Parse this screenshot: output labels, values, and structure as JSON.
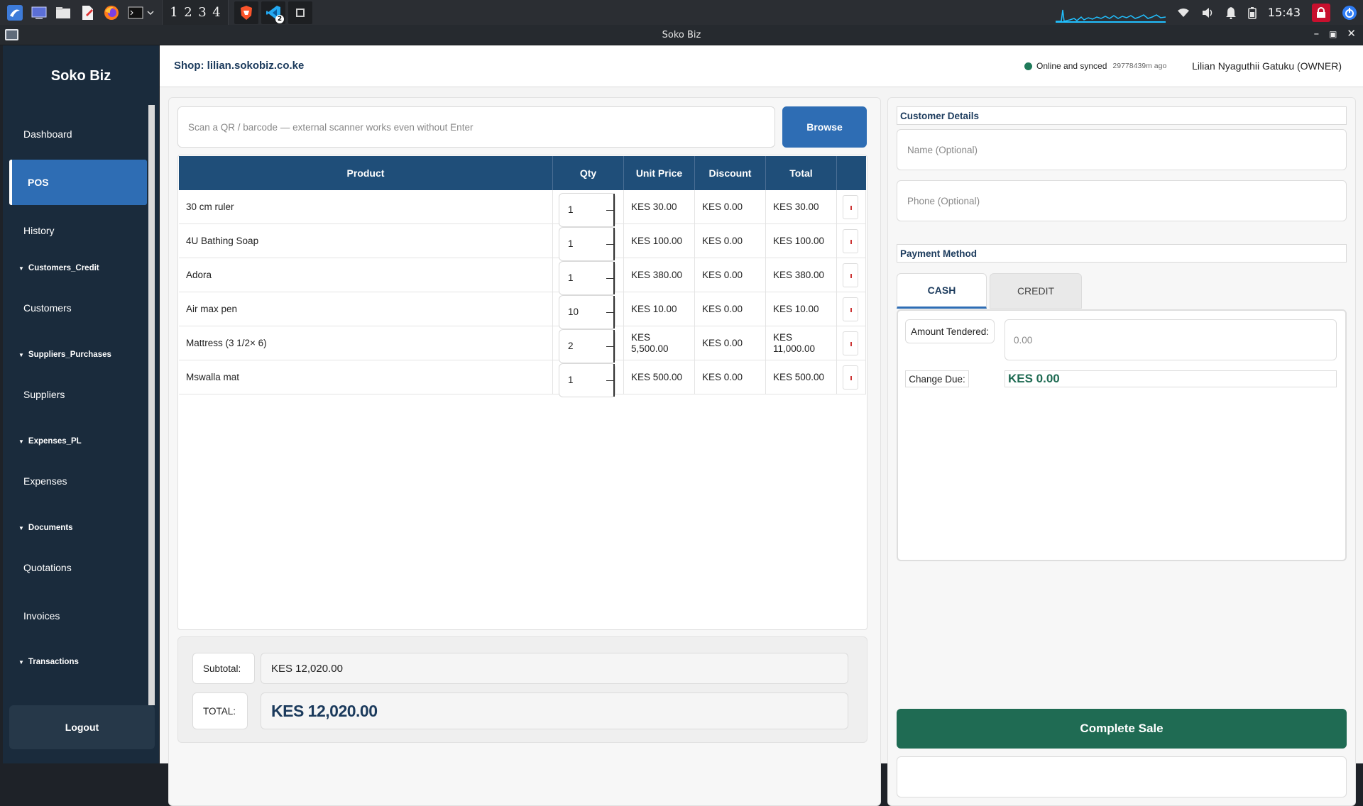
{
  "panel": {
    "workspaces": [
      "1",
      "2",
      "3",
      "4"
    ],
    "vscode_badge": "2",
    "clock": "15:43"
  },
  "window": {
    "title": "Soko Biz"
  },
  "sidebar": {
    "brand": "Soko Biz",
    "items": {
      "dashboard": "Dashboard",
      "pos": "POS",
      "history": "History",
      "group_customers": "Customers_Credit",
      "customers": "Customers",
      "group_suppliers": "Suppliers_Purchases",
      "suppliers": "Suppliers",
      "group_expenses": "Expenses_PL",
      "expenses": "Expenses",
      "group_documents": "Documents",
      "quotations": "Quotations",
      "invoices": "Invoices",
      "group_transactions": "Transactions"
    },
    "logout": "Logout"
  },
  "header": {
    "shop": "Shop: lilian.sokobiz.co.ke",
    "status": "Online and synced",
    "sync_ago": "29778439m ago",
    "user": "Lilian Nyaguthii Gatuku (OWNER)"
  },
  "pos": {
    "scan_placeholder": "Scan a QR / barcode — external scanner works even without Enter",
    "browse": "Browse",
    "columns": [
      "Product",
      "Qty",
      "Unit Price",
      "Discount",
      "Total",
      ""
    ],
    "rows": [
      {
        "product": "30 cm ruler",
        "qty": "1",
        "unit": "KES 30.00",
        "discount": "KES 0.00",
        "total": "KES 30.00"
      },
      {
        "product": "4U Bathing Soap",
        "qty": "1",
        "unit": "KES 100.00",
        "discount": "KES 0.00",
        "total": "KES 100.00"
      },
      {
        "product": "Adora",
        "qty": "1",
        "unit": "KES 380.00",
        "discount": "KES 0.00",
        "total": "KES 380.00"
      },
      {
        "product": "Air max pen",
        "qty": "10",
        "unit": "KES 10.00",
        "discount": "KES 0.00",
        "total": "KES 10.00"
      },
      {
        "product": "Mattress (3  1/2× 6)",
        "qty": "2",
        "unit": "KES 5,500.00",
        "discount": "KES 0.00",
        "total": "KES 11,000.00"
      },
      {
        "product": "Mswalla mat",
        "qty": "1",
        "unit": "KES 500.00",
        "discount": "KES 0.00",
        "total": "KES 500.00"
      }
    ],
    "subtotal_label": "Subtotal:",
    "subtotal": "KES 12,020.00",
    "total_label": "TOTAL:",
    "total": "KES 12,020.00"
  },
  "customer": {
    "section": "Customer Details",
    "name_placeholder": "Name (Optional)",
    "phone_placeholder": "Phone (Optional)"
  },
  "payment": {
    "section": "Payment Method",
    "tabs": [
      "CASH",
      "CREDIT"
    ],
    "tendered_label": "Amount Tendered:",
    "tendered_placeholder": "0.00",
    "change_label": "Change Due:",
    "change": "KES 0.00",
    "complete": "Complete Sale"
  },
  "colors": {
    "sidebar": "#1a2b3c",
    "accent": "#2e6db4",
    "header": "#1f4e79",
    "success": "#1f6b53"
  }
}
